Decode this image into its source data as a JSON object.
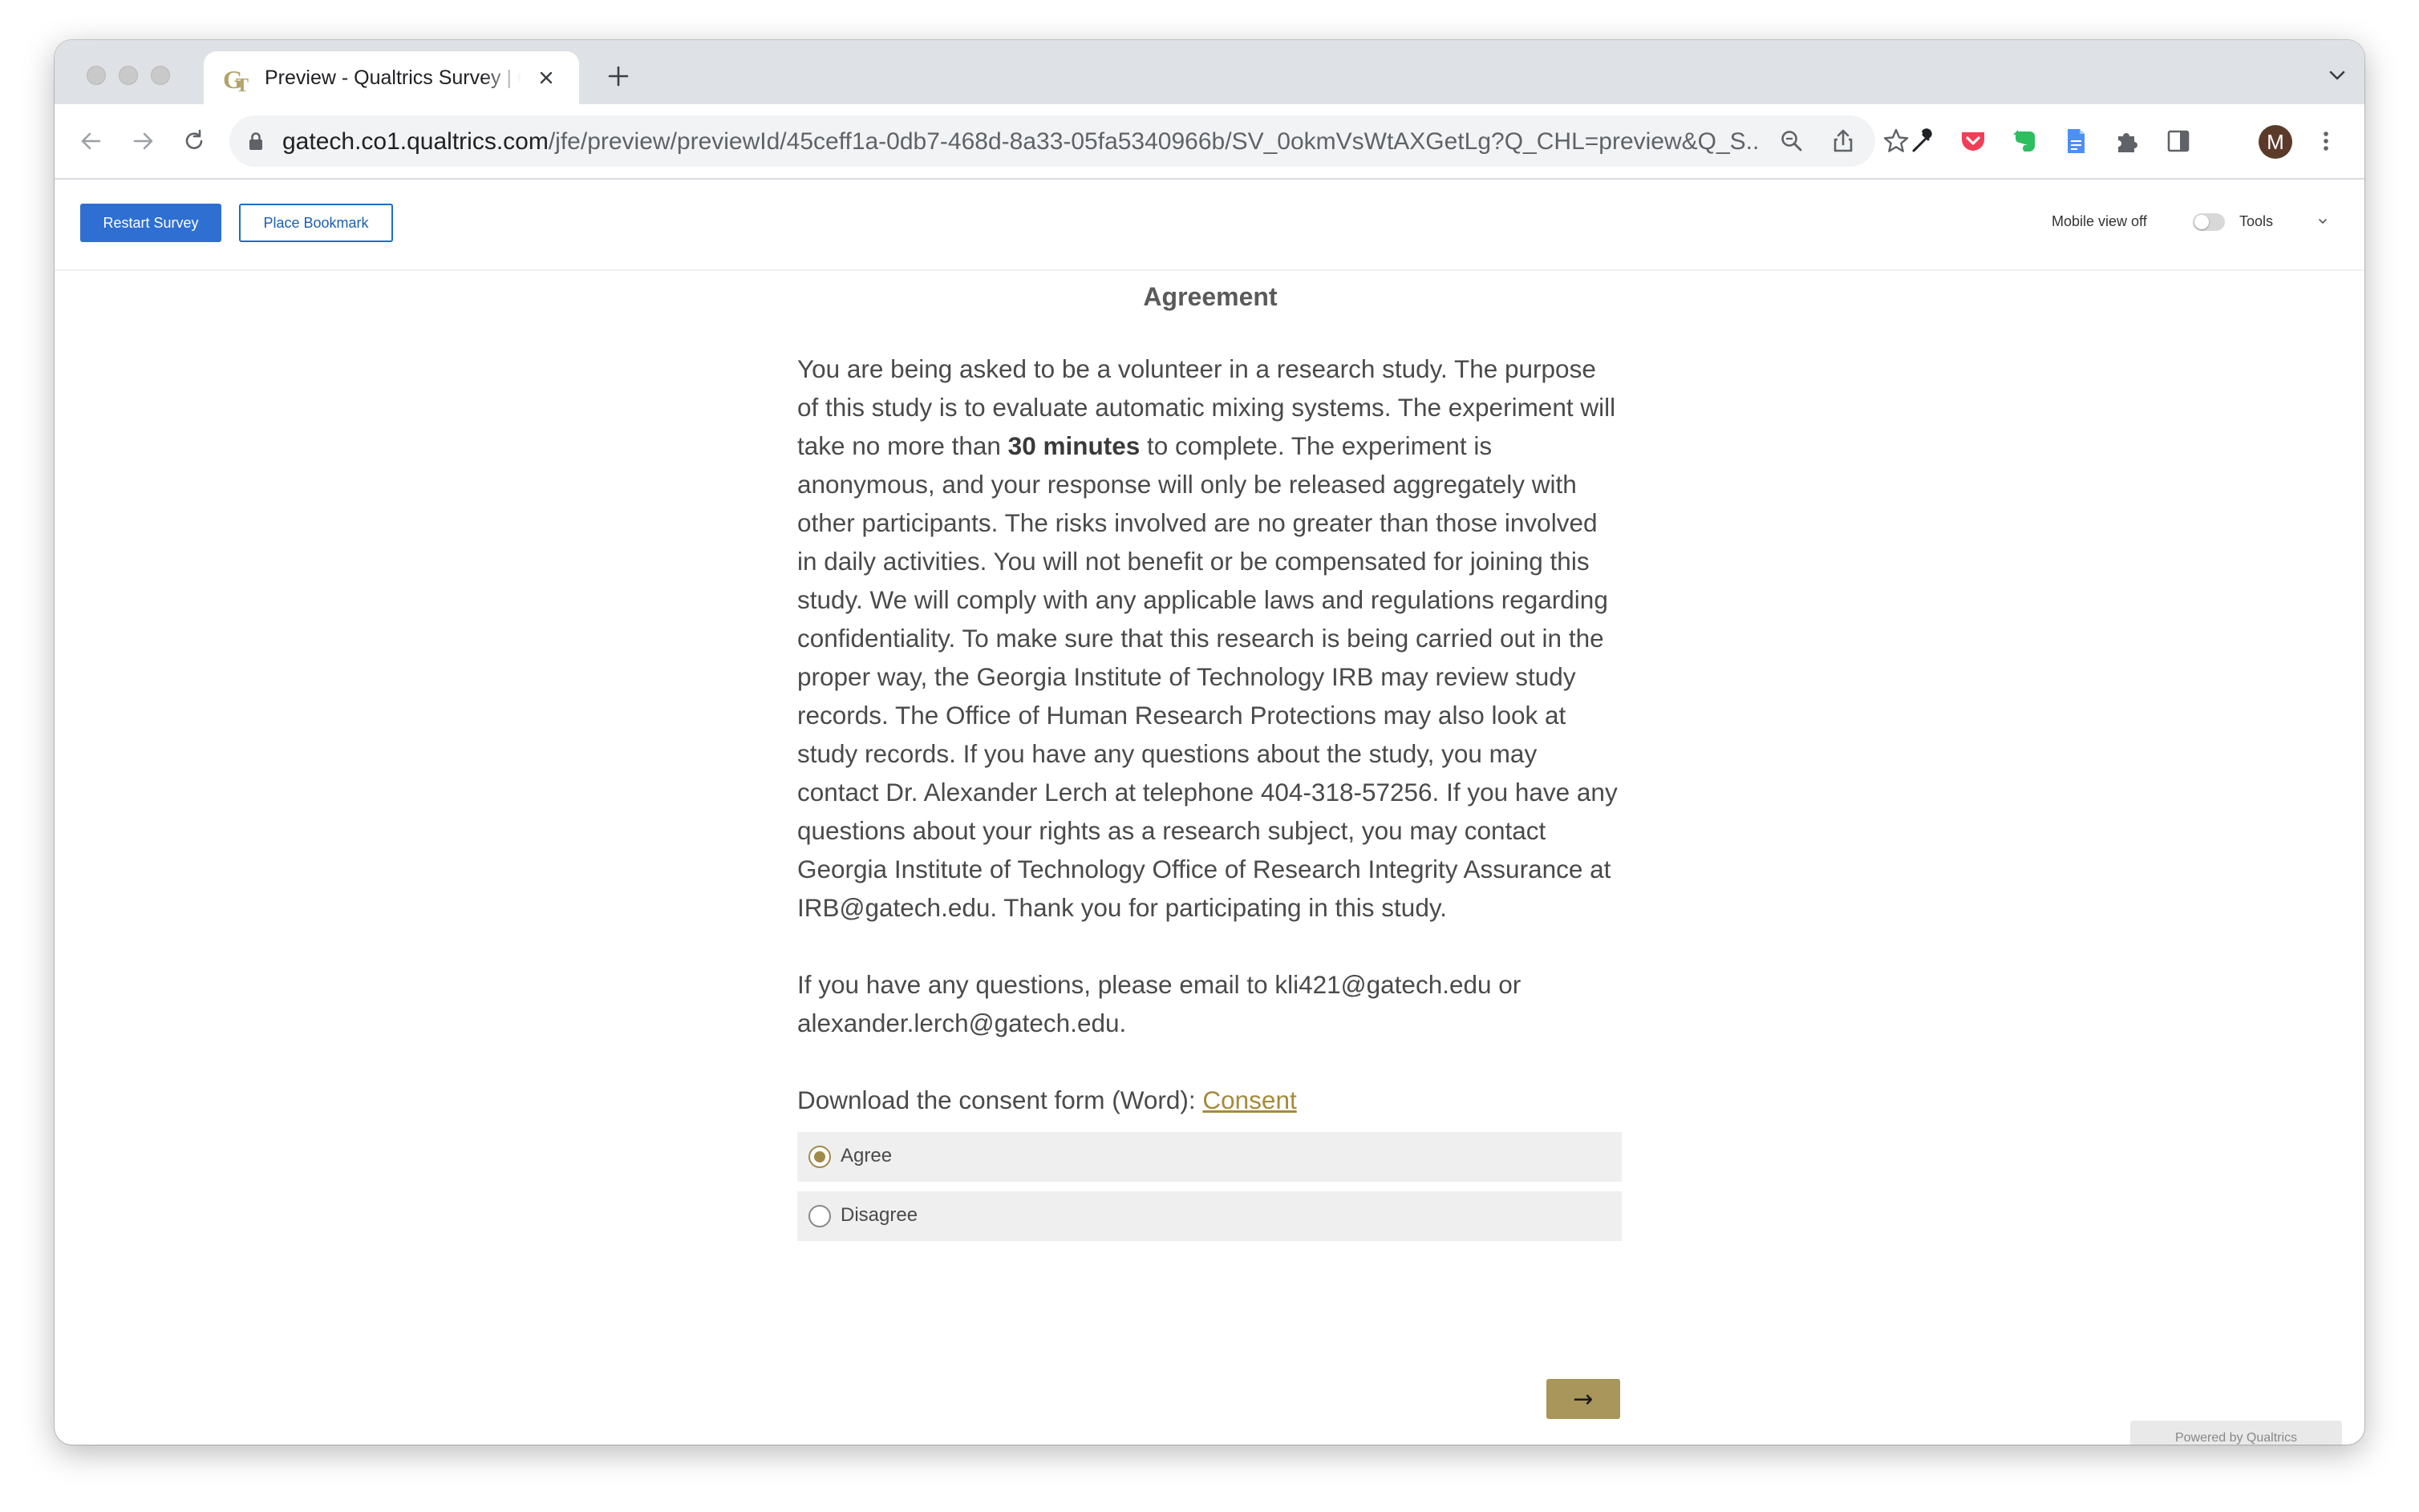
{
  "browser": {
    "tab_title": "Preview - Qualtrics Survey | Qualtrics",
    "url_host": "gatech.co1.qualtrics.com",
    "url_path": "/jfe/preview/previewId/45ceff1a-0db7-468d-8a33-05fa5340966b/SV_0okmVsWtAXGetLg?Q_CHL=preview&Q_S...",
    "profile_initial": "M"
  },
  "preview_bar": {
    "restart_label": "Restart Survey",
    "bookmark_label": "Place Bookmark",
    "mobile_view_label": "Mobile view off",
    "tools_label": "Tools",
    "mobile_view_on": false
  },
  "survey": {
    "title": "Agreement",
    "body_pre": "You are being asked to be a volunteer in a research study. The purpose of this study is to evaluate automatic mixing systems. The experiment will take no more than ",
    "body_bold": "30 minutes",
    "body_post": " to complete. The experiment is anonymous, and your response will only be released aggregately with other participants. The risks involved are no greater than those involved in daily activities. You will not benefit or be compensated for joining this study. We will comply with any applicable laws and regulations regarding confidentiality. To make sure that this research is being carried out in the proper way, the Georgia Institute of Technology IRB may review study records. The Office of Human Research Protections may also look at study records. If you have any questions about the study, you may contact Dr. Alexander Lerch at telephone 404-318-57256. If you have any questions about your rights as a research subject, you may contact Georgia Institute of Technology Office of Research Integrity Assurance at IRB@gatech.edu. Thank you for participating in this study.",
    "contact_text": "If you have any questions, please email to kli421@gatech.edu or alexander.lerch@gatech.edu.",
    "download_text": "Download the consent form (Word): ",
    "download_link": "Consent",
    "choices": [
      {
        "label": "Agree",
        "selected": true
      },
      {
        "label": "Disagree",
        "selected": false
      }
    ],
    "next_label": "→",
    "powered_by": "Powered by Qualtrics"
  },
  "colors": {
    "accent_blue": "#2e6fd1",
    "gold": "#a8965a",
    "link_gold": "#a68a3a"
  }
}
